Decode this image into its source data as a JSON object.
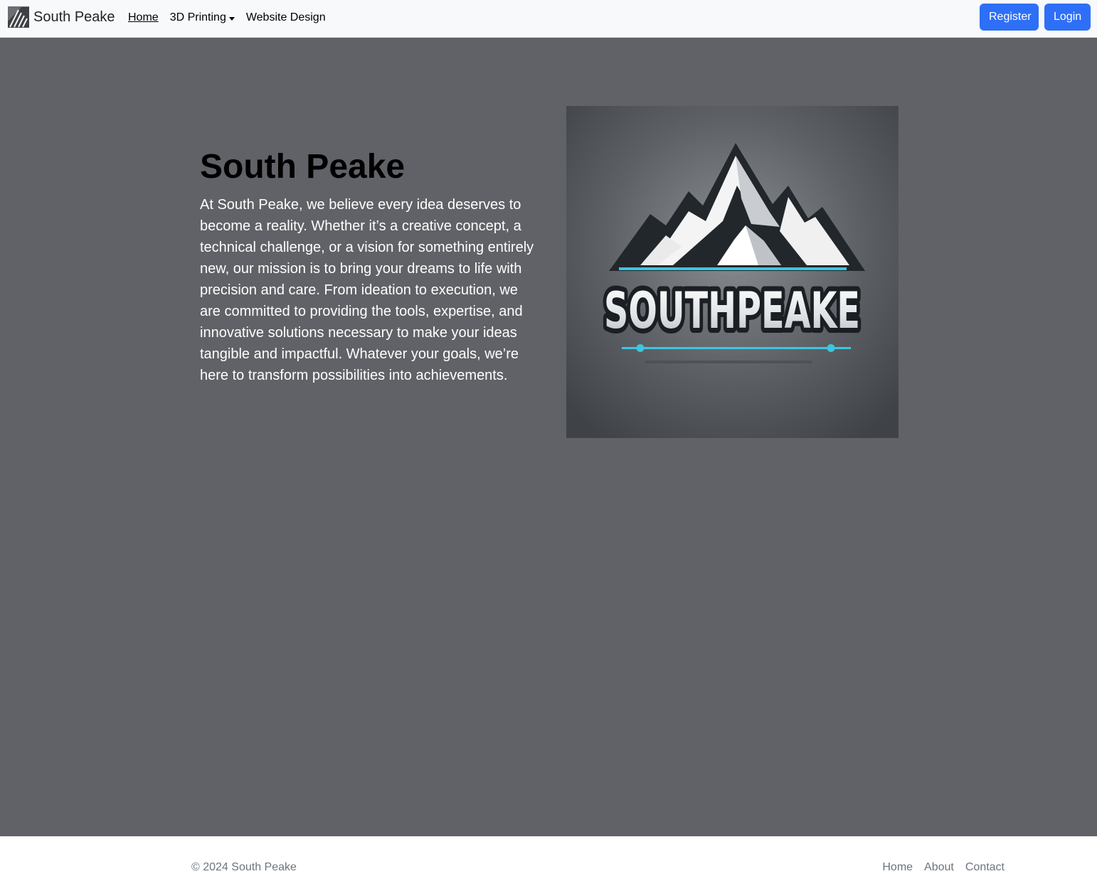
{
  "navbar": {
    "brand": "South Peake",
    "links": [
      {
        "label": "Home",
        "active": true
      },
      {
        "label": "3D Printing",
        "dropdown": true
      },
      {
        "label": "Website Design"
      }
    ],
    "register_label": "Register",
    "login_label": "Login"
  },
  "hero": {
    "title": "South Peake",
    "text": "At South Peake, we believe every idea deserves to become a reality. Whether it’s a creative concept, a technical challenge, or a vision for something entirely new, our mission is to bring your dreams to life with precision and care. From ideation to execution, we are committed to providing the tools, expertise, and innovative solutions necessary to make your ideas tangible and impactful. Whatever your goals, we’re here to transform possibilities into achievements.",
    "logo_wordmark": "SOUTHPEAKE"
  },
  "footer": {
    "copyright": "© 2024 South Peake",
    "links": [
      "Home",
      "About",
      "Contact"
    ]
  },
  "colors": {
    "page_background": "#616267",
    "navbar_background": "#f8f9fa",
    "button_primary": "#2e6ff7",
    "accent_cyan": "#3cc6e0",
    "footer_text": "#6c757d"
  },
  "icons": {
    "brand": "mountain-logo-icon",
    "dropdown": "caret-down-icon"
  }
}
